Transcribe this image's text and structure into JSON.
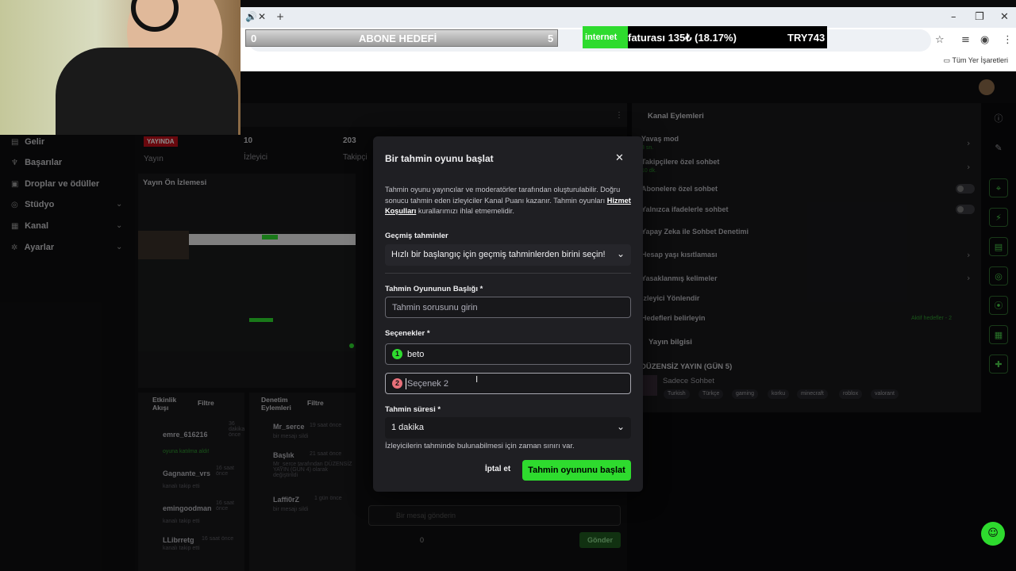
{
  "overlay": {
    "abone_left": "0",
    "abone_title": "ABONE HEDEFİ",
    "abone_right": "5",
    "ticker_highlight": "internet",
    "ticker_text": "faturası 135₺ (18.17%)",
    "ticker_code": "TRY743"
  },
  "browser": {
    "bookmarks_label": "Tüm Yer İşaretleri"
  },
  "sidebar": {
    "items": [
      {
        "label": "Gelir",
        "icon": "revenue-icon"
      },
      {
        "label": "Başarılar",
        "icon": "trophy-icon"
      },
      {
        "label": "Droplar ve ödüller",
        "icon": "gift-icon"
      },
      {
        "label": "Stüdyo",
        "icon": "studio-icon"
      },
      {
        "label": "Kanal",
        "icon": "channel-icon"
      },
      {
        "label": "Ayarlar",
        "icon": "gear-icon"
      }
    ]
  },
  "stats": {
    "live_badge": "YAYINDA",
    "live_label": "Yayın",
    "viewers_value": "10",
    "viewers_label": "İzleyici",
    "followers_value": "203",
    "followers_label": "Takipçi"
  },
  "preview": {
    "title": "Yayın Ön İzlemesi"
  },
  "activity": {
    "title": "Etkinlik Akışı",
    "filter": "Filtre",
    "items": [
      {
        "name": "emre_616216",
        "time": "36 dakika önce",
        "sub": "oyuna katılma aldı!"
      },
      {
        "name": "Gagnante_vrs",
        "time": "16 saat önce",
        "sub": "kanalı takip etti"
      },
      {
        "name": "emingoodman",
        "time": "16 saat önce",
        "sub": "kanalı takip etti"
      },
      {
        "name": "LLibrretg",
        "time": "16 saat önce",
        "sub": "kanalı takip etti"
      }
    ]
  },
  "moderation": {
    "title": "Denetim Eylemleri",
    "filter": "Filtre",
    "items": [
      {
        "name": "Mr_serce",
        "time": "19 saat önce",
        "sub": "bir mesajı sildi"
      },
      {
        "name": "Başlık",
        "time": "21 saat önce",
        "sub": "Mr_serce tarafından DÜZENSİZ YAYIN (GÜN 4) olarak değiştirildi"
      },
      {
        "name": "Laffi0rZ",
        "time": "1 gün önce",
        "sub": "bir mesajı sildi"
      }
    ]
  },
  "chat": {
    "placeholder": "Bir mesaj gönderin",
    "points": "0",
    "send": "Gönder"
  },
  "channel_actions": {
    "title": "Kanal Eylemleri",
    "items": [
      {
        "label": "Yavaş mod",
        "sub": "3 sn."
      },
      {
        "label": "Takipçilere özel sohbet",
        "sub": "10 dk."
      },
      {
        "label": "Abonelere özel sohbet"
      },
      {
        "label": "Yalnızca ifadelerle sohbet"
      },
      {
        "label": "Yapay Zeka ile Sohbet Denetimi"
      },
      {
        "label": "Hesap yaşı kısıtlaması"
      },
      {
        "label": "Yasaklanmış kelimeler"
      },
      {
        "label": "İzleyici Yönlendir"
      },
      {
        "label": "Hedefleri belirleyin",
        "badge": "Aktif hedefler - 2"
      }
    ]
  },
  "stream_info": {
    "title": "Yayın bilgisi",
    "stream_title": "DÜZENSİZ YAYIN (GÜN 5)",
    "category": "Sadece Sohbet",
    "tags": [
      "Turkish",
      "Türkçe",
      "gaming",
      "korku",
      "minecraft",
      "roblox",
      "valorant"
    ]
  },
  "modal": {
    "title": "Bir tahmin oyunu başlat",
    "desc_1": "Tahmin oyunu yayıncılar ve moderatörler tarafından oluşturulabilir. Doğru sonucu tahmin eden izleyiciler Kanal Puanı kazanır. Tahmin oyunları ",
    "desc_link": "Hizmet Koşulları",
    "desc_2": " kurallarımızı ihlal etmemelidir.",
    "past_label": "Geçmiş tahminler",
    "past_select": "Hızlı bir başlangıç için geçmiş tahminlerden birini seçin!",
    "title_label": "Tahmin Oyununun Başlığı *",
    "title_placeholder": "Tahmin sorusunu girin",
    "options_label": "Seçenekler *",
    "option1_num": "1",
    "option1_value": "beto",
    "option2_num": "2",
    "option2_placeholder": "Seçenek 2",
    "duration_label": "Tahmin süresi *",
    "duration_value": "1 dakika",
    "hint": "İzleyicilerin tahminde bulunabilmesi için zaman sınırı var.",
    "cancel": "İptal et",
    "start": "Tahmin oyununu başlat"
  },
  "colors": {
    "accent": "#2edb2e",
    "option1": "#2edb2e",
    "option2": "#e8707a",
    "live": "#c0101a"
  }
}
